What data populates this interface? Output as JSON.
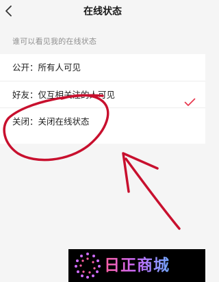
{
  "header": {
    "title": "在线状态",
    "back_icon": "chevron-left-icon"
  },
  "section": {
    "label": "谁可以看见我的在线状态"
  },
  "options": [
    {
      "label": "公开：所有人可见",
      "selected": false
    },
    {
      "label": "好友：仅互相关注的人可见",
      "selected": true
    },
    {
      "label": "关闭：关闭在线状态",
      "selected": false
    }
  ],
  "check_icon": "checkmark-icon",
  "colors": {
    "accent": "#e8354c",
    "annotation": "#c8102e",
    "background": "#f5f5f5",
    "secondary_text": "#8f8f8f"
  },
  "watermark": {
    "text": "日正商城"
  }
}
